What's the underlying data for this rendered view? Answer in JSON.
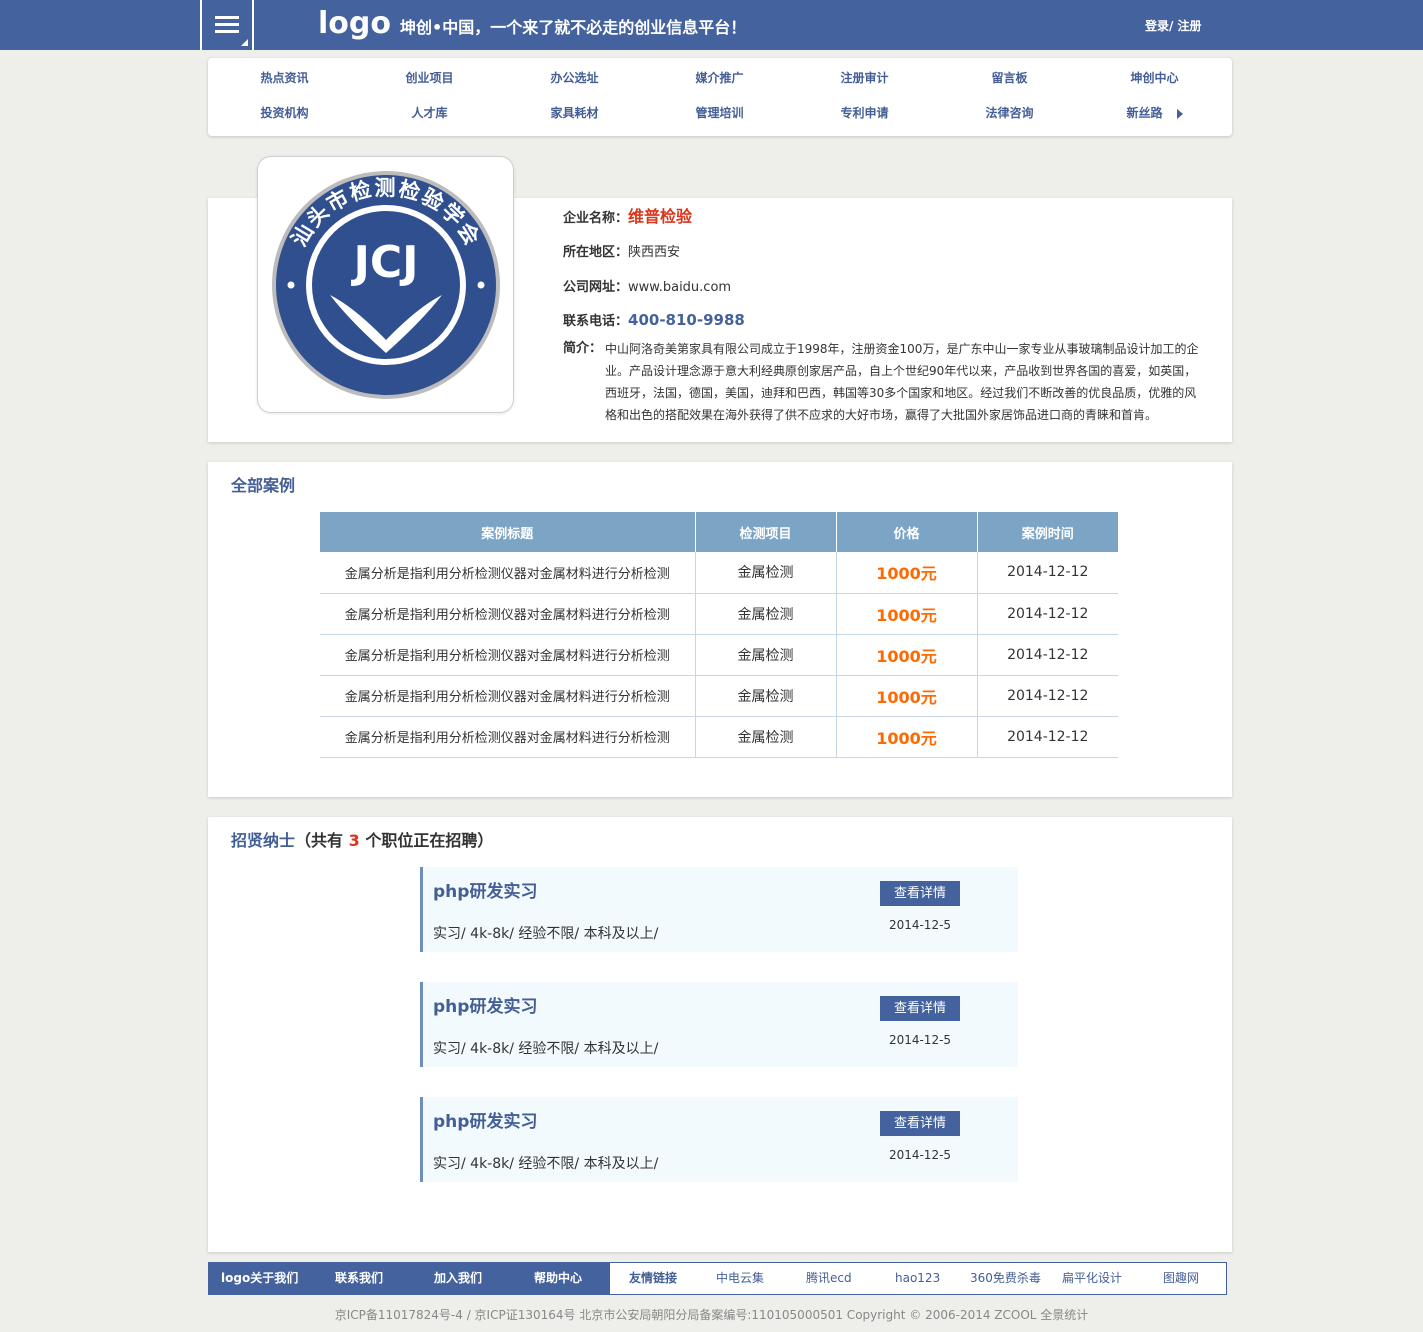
{
  "header": {
    "logo": "logo",
    "slogan": "坤创•中国，一个来了就不必走的创业信息平台！",
    "login": "登录/ 注册"
  },
  "nav": {
    "row1": [
      "热点资讯",
      "创业项目",
      "办公选址",
      "媒介推广",
      "注册审计",
      "留言板",
      "坤创中心"
    ],
    "row2": [
      "投资机构",
      "人才库",
      "家具耗材",
      "管理培训",
      "专利申请",
      "法律咨询",
      "新丝路"
    ]
  },
  "company": {
    "logo_text": "JCJ",
    "logo_ring_text": "汕头市检测检验学会",
    "name_label": "企业名称：",
    "name": "维普检验",
    "region_label": "所在地区：",
    "region": "陕西西安",
    "website_label": "公司网址：",
    "website": "www.baidu.com",
    "phone_label": "联系电话：",
    "phone": "400-810-9988",
    "intro_label": "简介：",
    "intro": "中山阿洛奇美第家具有限公司成立于1998年，注册资金100万，是广东中山一家专业从事玻璃制品设计加工的企业。产品设计理念源于意大利经典原创家居产品，自上个世纪90年代以来，产品收到世界各国的喜爱，如英国，西班牙，法国，德国，美国，迪拜和巴西，韩国等30多个国家和地区。经过我们不断改善的优良品质，优雅的风格和出色的搭配效果在海外获得了供不应求的大好市场，赢得了大批国外家居饰品进口商的青睐和首肯。",
    "colors": {
      "accent": "#d9371d",
      "brand": "#44629d"
    }
  },
  "cases": {
    "title": "全部案例",
    "headers": [
      "案例标题",
      "检测项目",
      "价格",
      "案例时间"
    ],
    "rows": [
      [
        "金属分析是指利用分析检测仪器对金属材料进行分析检测",
        "金属检测",
        "1000元",
        "2014-12-12"
      ],
      [
        "金属分析是指利用分析检测仪器对金属材料进行分析检测",
        "金属检测",
        "1000元",
        "2014-12-12"
      ],
      [
        "金属分析是指利用分析检测仪器对金属材料进行分析检测",
        "金属检测",
        "1000元",
        "2014-12-12"
      ],
      [
        "金属分析是指利用分析检测仪器对金属材料进行分析检测",
        "金属检测",
        "1000元",
        "2014-12-12"
      ],
      [
        "金属分析是指利用分析检测仪器对金属材料进行分析检测",
        "金属检测",
        "1000元",
        "2014-12-12"
      ]
    ]
  },
  "jobs": {
    "title": "招贤纳士",
    "count_prefix": "（共有",
    "count": "3",
    "count_suffix": "个职位正在招聘）",
    "items": [
      {
        "title": "php研发实习",
        "meta": "实习/ 4k-8k/ 经验不限/ 本科及以上/",
        "button": "查看详情",
        "date": "2014-12-5"
      },
      {
        "title": "php研发实习",
        "meta": "实习/ 4k-8k/ 经验不限/ 本科及以上/",
        "button": "查看详情",
        "date": "2014-12-5"
      },
      {
        "title": "php研发实习",
        "meta": "实习/ 4k-8k/ 经验不限/ 本科及以上/",
        "button": "查看详情",
        "date": "2014-12-5"
      }
    ]
  },
  "footer": {
    "left_links": [
      "logo关于我们",
      "联系我们",
      "加入我们",
      "帮助中心"
    ],
    "friend_label": "友情链接",
    "right_links": [
      "中电云集",
      "腾讯ecd",
      "hao123",
      "360免费杀毒",
      "扁平化设计",
      "图趣网"
    ],
    "copyright": "京ICP备11017824号-4 / 京ICP证130164号 北京市公安局朝阳分局备案编号:110105000501 Copyright © 2006-2014 ZCOOL 全景统计"
  }
}
